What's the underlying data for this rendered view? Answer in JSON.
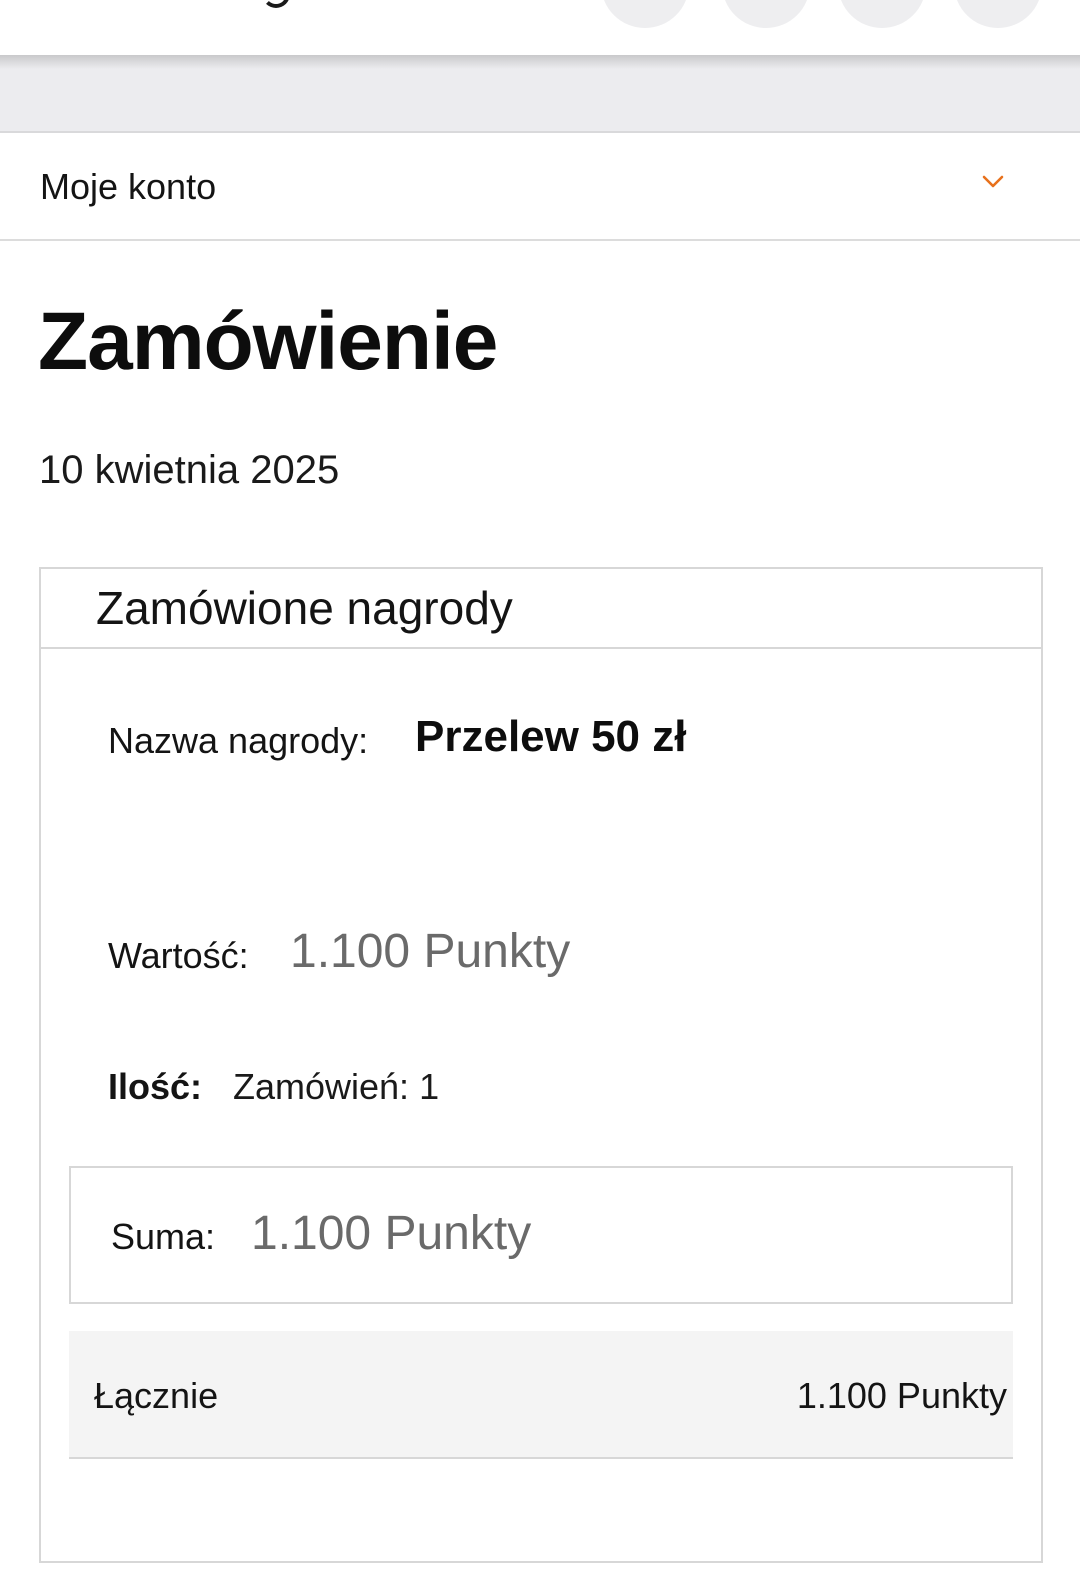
{
  "header": {
    "icons": [
      "search-icon",
      "cart-icon",
      "user-icon",
      "menu-icon"
    ]
  },
  "account_menu": {
    "label": "Moje konto",
    "icon": "chevron-down-icon",
    "accent_color": "#e8711c"
  },
  "page": {
    "title": "Zamówienie",
    "date": "10 kwietnia 2025"
  },
  "ordered_rewards": {
    "section_title": "Zamówione nagrody",
    "name_label": "Nazwa nagrody:",
    "name_value": "Przelew 50 zł",
    "value_label": "Wartość:",
    "value_value": "1.100 Punkty",
    "quantity_label": "Ilość:",
    "quantity_value": "Zamówień: 1",
    "sum_label": "Suma:",
    "sum_value": "1.100 Punkty",
    "total_label": "Łącznie",
    "total_value": "1.100 Punkty"
  }
}
